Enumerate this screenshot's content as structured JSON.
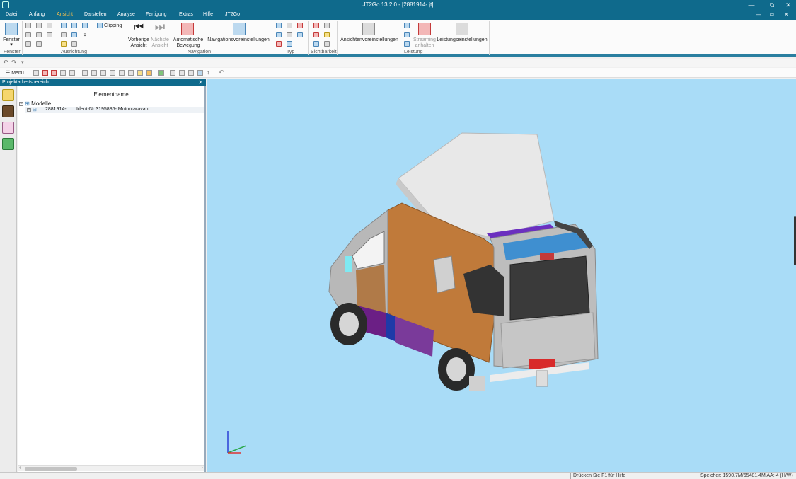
{
  "window": {
    "title": "JT2Go 13.2.0 - [2881914-.jt]",
    "minimize": "—",
    "restore": "⧉",
    "close": "✕"
  },
  "menu": {
    "tabs": [
      "Datei",
      "Anfang",
      "Ansicht",
      "Darstellen",
      "Analyse",
      "Fertigung",
      "Extras",
      "Hilfe",
      "JT2Go"
    ],
    "active": "Ansicht",
    "right_controls": [
      "—",
      "⧉",
      "✕"
    ]
  },
  "ribbon": {
    "fenster": {
      "label": "Fenster",
      "group": "Fenster"
    },
    "ausrichtung": {
      "group": "Ausrichtung",
      "clipping": "Clipping"
    },
    "navigation": {
      "group": "Navigation",
      "prev": "Vorherige\nAnsicht",
      "next": "Nächste\nAnsicht",
      "auto": "Automatische\nBewegung",
      "settings": "Navigationsvoreinstellungen"
    },
    "typ": {
      "group": "Typ"
    },
    "sichtbarkeit": {
      "group": "Sichtbarkeit"
    },
    "leistung": {
      "group": "Leistung",
      "view_settings": "Ansichtenvoreinstellungen",
      "streaming": "Streaming\nanhalten",
      "perf_settings": "Leistungseinstellungen"
    }
  },
  "toolbar": {
    "menu_label": "☰ Menü"
  },
  "panel": {
    "title": "Projektarbeitsbereich",
    "close": "✕",
    "column_header": "Elementname",
    "root": "Modelle",
    "child_id": "2881914-",
    "child_name": "Ident-Nr 3195886- Motorcaravan"
  },
  "statusbar": {
    "help": "Drücken Sie F1 für Hilfe",
    "memory": "Speicher: 1590.7M/65481.4M  AA: 4 (H/W)"
  },
  "colors": {
    "titlebar": "#0f6a8c",
    "active_tab": "#ffc34a",
    "viewport_bg": "#a9dcf7"
  }
}
